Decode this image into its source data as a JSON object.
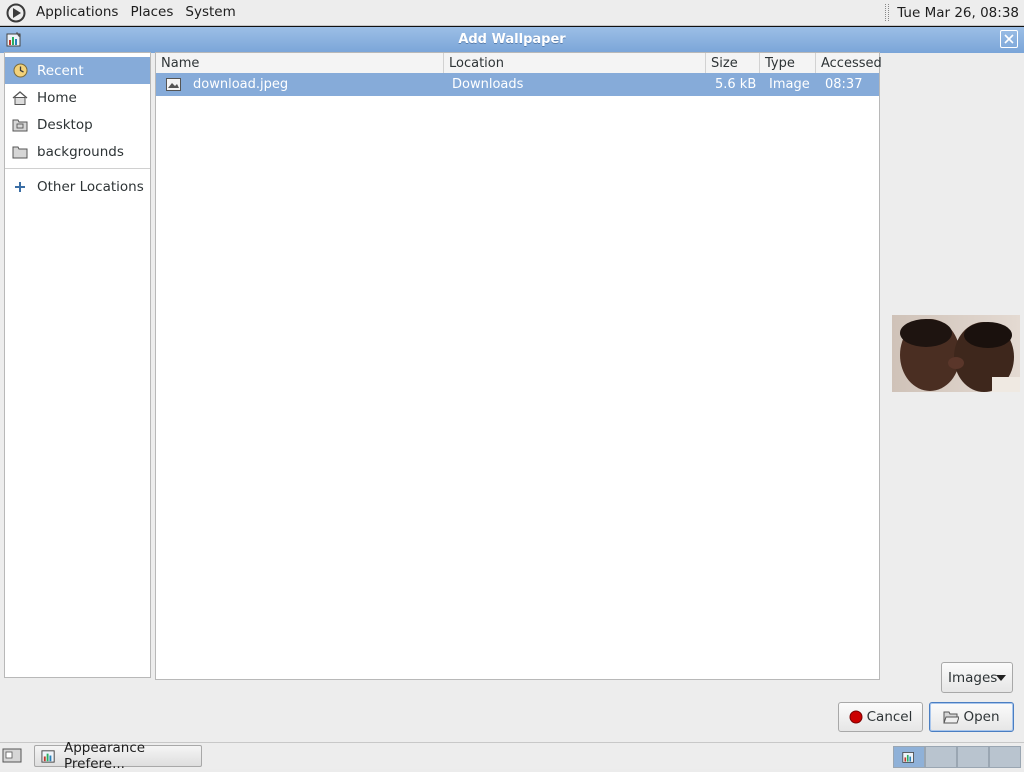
{
  "top_panel": {
    "menus": [
      "Applications",
      "Places",
      "System"
    ],
    "clock": "Tue Mar 26, 08:38"
  },
  "dialog": {
    "title": "Add Wallpaper",
    "sidebar": {
      "items": [
        {
          "label": "Recent",
          "icon": "recent-clock-icon",
          "selected": true
        },
        {
          "label": "Home",
          "icon": "home-icon"
        },
        {
          "label": "Desktop",
          "icon": "desktop-icon"
        },
        {
          "label": "backgrounds",
          "icon": "folder-icon"
        }
      ],
      "other_locations": {
        "label": "Other Locations",
        "icon": "plus-icon"
      }
    },
    "file_list": {
      "columns": [
        "Name",
        "Location",
        "Size",
        "Type",
        "Accessed"
      ],
      "rows": [
        {
          "name": "download.jpeg",
          "location": "Downloads",
          "size": "5.6 kB",
          "type": "Image",
          "accessed": "08:37",
          "icon": "image-file-icon",
          "selected": true
        }
      ]
    },
    "filter": {
      "selected": "Images"
    },
    "buttons": {
      "cancel": "Cancel",
      "open": "Open"
    }
  },
  "bottom_panel": {
    "task_label": "Appearance Prefere..."
  },
  "colors": {
    "selection": "#86abd9",
    "titlebar": "#7aa5d8",
    "panel": "#ededed"
  }
}
